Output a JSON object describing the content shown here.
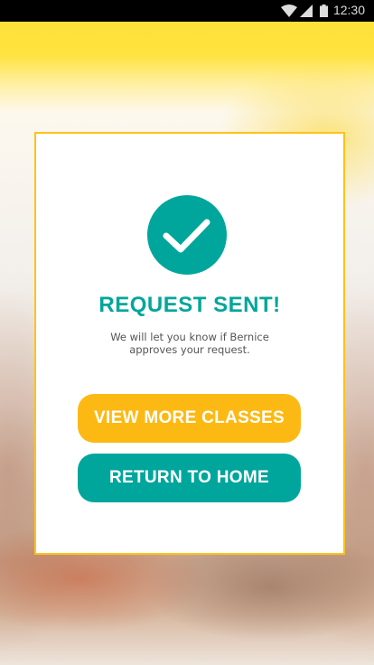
{
  "status_bar": {
    "time": "12:30",
    "icons": [
      "wifi-icon",
      "signal-icon",
      "battery-icon"
    ]
  },
  "dialog": {
    "icon": "check-circle-icon",
    "title": "REQUEST SENT!",
    "message": "We will let you know if Bernice approves your request.",
    "primary_button": "VIEW MORE CLASSES",
    "secondary_button": "RETURN TO HOME"
  },
  "colors": {
    "teal": "#00a69c",
    "yellow": "#fdb913",
    "border": "#ffc21a"
  }
}
